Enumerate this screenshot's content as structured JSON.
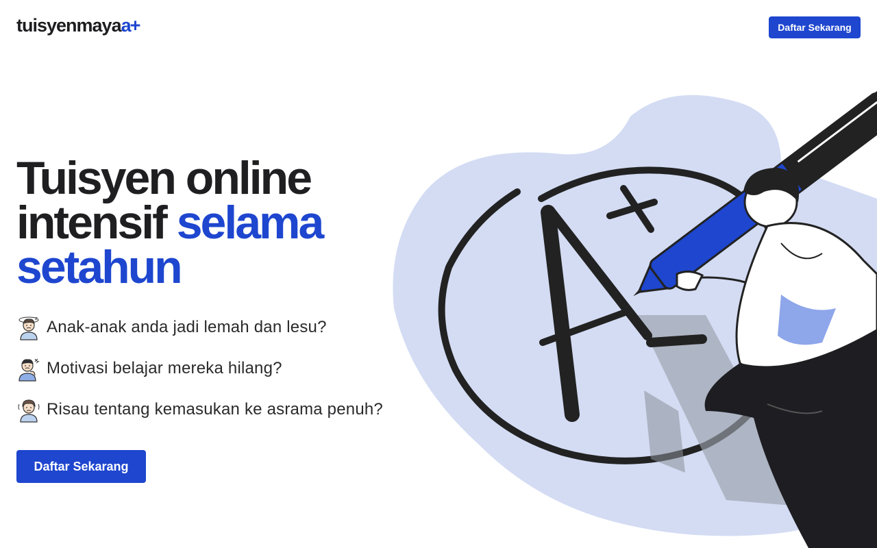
{
  "header": {
    "logo_main": "tuisyenmaya",
    "logo_accent": "a+",
    "cta_label": "Daftar Sekarang"
  },
  "hero": {
    "title_line1": "Tuisyen online",
    "title_line2_dark": "intensif ",
    "title_line2_blue": "selama",
    "title_line3_blue": "setahun",
    "points": [
      {
        "icon": "tired-child-icon",
        "text": "Anak-anak anda jadi lemah dan lesu?"
      },
      {
        "icon": "frustrated-child-icon",
        "text": "Motivasi belajar mereka hilang?"
      },
      {
        "icon": "worried-child-icon",
        "text": "Risau tentang kemasukan ke asrama penuh?"
      }
    ],
    "cta_label": "Daftar Sekarang"
  },
  "illustration": {
    "grade_text": "A+",
    "icon": "student-writing-grade-illustration"
  },
  "colors": {
    "brand_blue": "#1e46cf",
    "blob": "#d3dcf3",
    "text_dark": "#1f1f21"
  }
}
